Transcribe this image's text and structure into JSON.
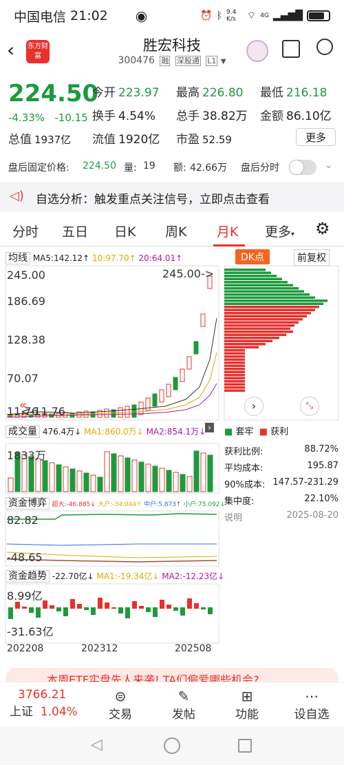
{
  "status": {
    "carrier": "中国电信",
    "time": "21:02",
    "net_speed": "9.4 K/s",
    "signal": "4G"
  },
  "header": {
    "title": "胜宏科技",
    "code": "300476",
    "tag1": "融",
    "tag2": "深股通",
    "tag3": "L1",
    "logo": "东方财富"
  },
  "quote": {
    "price": "224.50",
    "change_pct": "-4.33%",
    "change": "-10.15",
    "open_label": "今开",
    "open": "223.97",
    "high_label": "最高",
    "high": "226.80",
    "low_label": "最低",
    "low": "216.18",
    "turnover_label": "换手",
    "turnover": "4.54%",
    "volume_label": "总手",
    "volume": "38.82万",
    "amount_label": "金额",
    "amount": "86.10亿",
    "mcap_label": "总值",
    "mcap": "1937亿",
    "float_label": "流值",
    "float": "1920亿",
    "pe_label": "市盈",
    "pe": "52.59",
    "more": "更多"
  },
  "after": {
    "label": "盘后固定价格:",
    "price": "224.50",
    "vol_label": "量:",
    "vol": "19",
    "amt_label": "额:",
    "amt": "42.66万",
    "time_label": "盘后分时"
  },
  "banner": {
    "text": "自选分析：触发重点关注信号，立即点击查看"
  },
  "tabs": [
    "分时",
    "五日",
    "日K",
    "周K",
    "月K",
    "更多"
  ],
  "chart": {
    "ma_label": "均线",
    "ma5": "MA5:142.12↑",
    "ma10": "10:97.70↑",
    "ma20": "20:64.01↑",
    "dk": "DK点",
    "adj": "前复权",
    "y_labels": [
      "245.00",
      "186.69",
      "128.38",
      "70.07",
      "11.76"
    ],
    "max_mark": "245.00->",
    "min_mark": "<-11.76",
    "vol_label": "成交量",
    "vol_v": "476.4万↓",
    "vol_ma1": "MA1:860.0万↓",
    "vol_ma2": "MA2:854.1万↓",
    "vol_max": "1833万",
    "game_label": "资金博弈",
    "game_a": "超大:-46.885↓",
    "game_b": "大户:-34.044↑",
    "game_c": "中户:5.873↑",
    "game_d": "小户:75.092↓",
    "game_hi": "82.82",
    "game_lo": "-48.65",
    "trend_label": "资金趋势",
    "trend_v": "-22.70亿↓",
    "trend_ma1": "MA1:-19.34亿↓",
    "trend_ma2": "MA2:-12.23亿↓",
    "trend_hi": "8.99亿",
    "trend_lo": "-31.63亿",
    "dates": [
      "202208",
      "202312",
      "202508"
    ]
  },
  "chip": {
    "legend_a": "套牢",
    "legend_b": "获利",
    "rows": [
      [
        "获利比例:",
        "88.72%"
      ],
      [
        "平均成本:",
        "195.87"
      ],
      [
        "90%成本:",
        "147.57-231.29"
      ],
      [
        "集中度:",
        "22.10%"
      ]
    ],
    "note": "说明",
    "date": "2025-08-20"
  },
  "ticker": {
    "text": "本周ETF实盘先人来袭! TA们偏爱哪些机会?"
  },
  "bottom": {
    "index_name": "上证",
    "index_val": "3766.21",
    "index_pct": "1.04%",
    "items": [
      "交易",
      "发帖",
      "功能",
      "设自选"
    ]
  }
}
